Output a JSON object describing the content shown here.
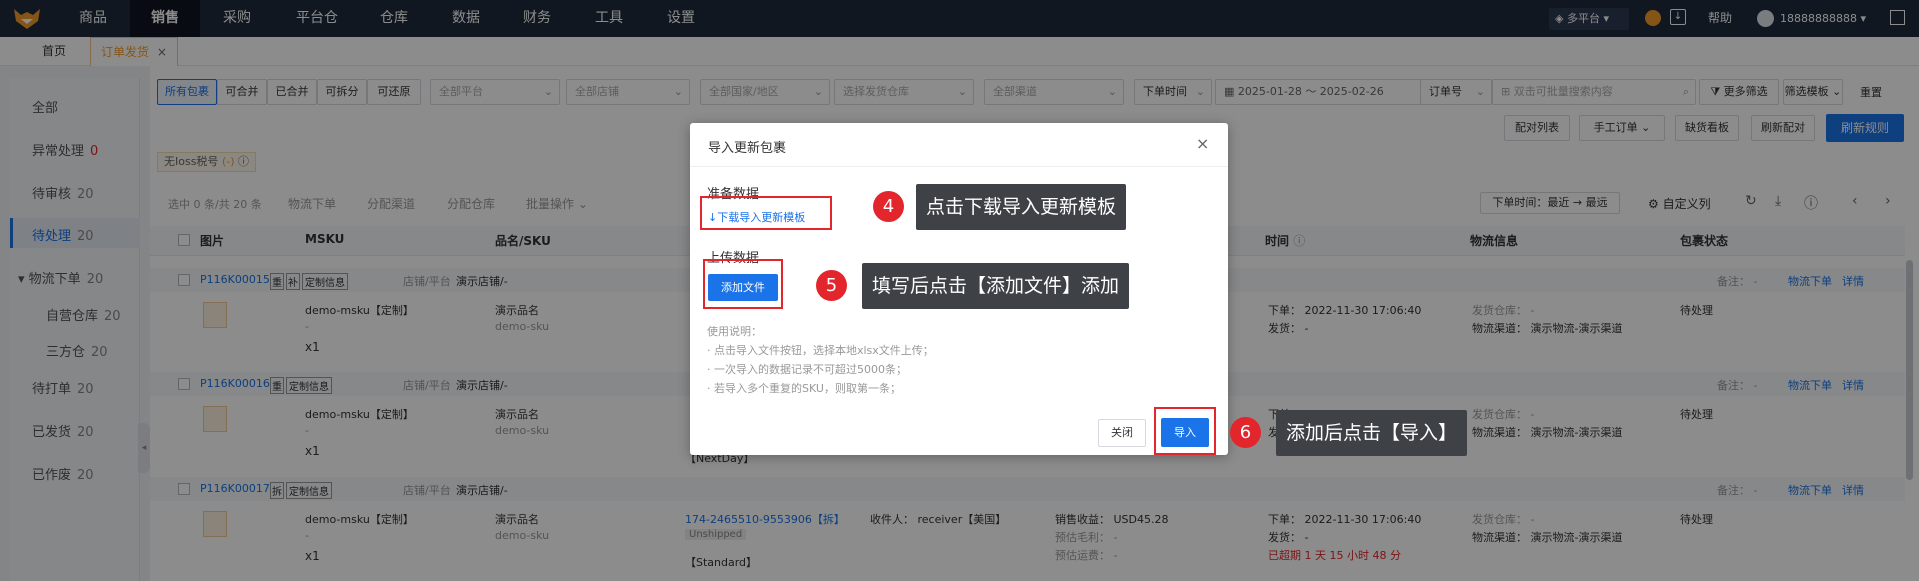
{
  "nav": {
    "items": [
      "商品",
      "销售",
      "采购",
      "平台仓",
      "仓库",
      "数据",
      "财务",
      "工具",
      "设置"
    ],
    "platform": "多平台",
    "help": "帮助",
    "user": "18888888888"
  },
  "tabs": {
    "home": "首页",
    "order": "订单发货"
  },
  "sidebar": {
    "items": [
      {
        "label": "全部",
        "count": ""
      },
      {
        "label": "异常处理",
        "count": "0"
      },
      {
        "label": "待审核",
        "count": "20"
      },
      {
        "label": "待处理",
        "count": "20"
      },
      {
        "label": "物流下单",
        "count": "20"
      },
      {
        "label": "自营仓库",
        "count": "20"
      },
      {
        "label": "三方仓",
        "count": "20"
      },
      {
        "label": "待打单",
        "count": "20"
      },
      {
        "label": "已发货",
        "count": "20"
      },
      {
        "label": "已作废",
        "count": "20"
      }
    ]
  },
  "filters": {
    "segments": [
      "所有包裹",
      "可合并",
      "已合并",
      "可拆分",
      "可还原"
    ],
    "platform": "全部平台",
    "shop": "全部店铺",
    "country": "全部国家/地区",
    "warehouse": "选择发货仓库",
    "channel": "全部渠道",
    "time_type": "下单时间",
    "date_range": "2025-01-28 ～ 2025-02-26",
    "order_no": "订单号",
    "search_placeholder": "双击可批量搜索内容",
    "more_filter": "更多筛选",
    "filter_template": "筛选模板",
    "reset": "重置"
  },
  "actions": {
    "match_list": "配对列表",
    "manual_order": "手工订单",
    "stock_board": "缺货看板",
    "refresh_match": "刷新配对",
    "refresh_rules": "刷新规则"
  },
  "tax_tag": "无Ioss税号",
  "tax_tag_count": "(-)",
  "toolbar": {
    "selected": "选中 0 条/共 20 条",
    "logistics_order": "物流下单",
    "assign_channel": "分配渠道",
    "assign_warehouse": "分配仓库",
    "batch_ops": "批量操作",
    "sort": "下单时间：最近 → 最远",
    "custom_cols": "自定义列"
  },
  "table": {
    "headers": [
      "图片",
      "MSKU",
      "品名/SKU",
      "时间",
      "物流信息",
      "包裹状态"
    ],
    "rows": [
      {
        "id": "P116K00015",
        "tags": [
          "重",
          "补"
        ],
        "custom": "定制信息",
        "shop_label": "店铺/平台",
        "shop": "演示店铺/-",
        "msku": "demo-msku【定制】",
        "dash": "-",
        "qty": "x1",
        "name": "演示品名",
        "sku": "demo-sku",
        "order_time": "下单： 2022-11-30 17:06:40",
        "ship": "发货： -",
        "wh": "发货仓库： -",
        "ch": "物流渠道： 演示物流-演示渠道",
        "status": "待处理",
        "note": "备注： -",
        "act1": "物流下单",
        "act2": "详情"
      },
      {
        "id": "P116K00016",
        "tags": [
          "重"
        ],
        "custom": "定制信息",
        "shop_label": "店铺/平台",
        "shop": "演示店铺/-",
        "msku": "demo-msku【定制】",
        "dash": "-",
        "qty": "x1",
        "name": "演示品名",
        "sku": "demo-sku",
        "order_time": "下单： 2022-11-30 17:06:40",
        "ship": "发货： -",
        "wh": "发货仓库： -",
        "ch": "物流渠道： 演示物流-演示渠道",
        "status": "待处理",
        "note": "备注： -",
        "act1": "物流下单",
        "act2": "详情",
        "service": "【NextDay】"
      },
      {
        "id": "P116K00017",
        "tags": [
          "拆"
        ],
        "custom": "定制信息",
        "shop_label": "店铺/平台",
        "shop": "演示店铺/-",
        "msku": "demo-msku【定制】",
        "dash": "-",
        "qty": "x1",
        "name": "演示品名",
        "sku": "demo-sku",
        "order_no": "174-2465510-9553906【拆】",
        "unshipped": "Unshipped",
        "service": "【Standard】",
        "receiver": "收件人： receiver【美国】",
        "sales": "销售收益： USD45.28",
        "profit": "预估毛利： -",
        "freight": "预估运费： -",
        "order_time": "下单： 2022-11-30 17:06:40",
        "ship": "发货： -",
        "overdue": "已超期 1 天 15 小时 48 分",
        "wh": "发货仓库： -",
        "ch": "物流渠道： 演示物流-演示渠道",
        "status": "待处理",
        "note": "备注： -",
        "act1": "物流下单",
        "act2": "详情"
      }
    ]
  },
  "modal": {
    "title": "导入更新包裹",
    "prepare": "准备数据",
    "download_link": "下载导入更新模板",
    "upload": "上传数据",
    "add_file": "添加文件",
    "usage_title": "使用说明：",
    "usage": [
      "· 点击导入文件按钮，选择本地xlsx文件上传；",
      "· 一次导入的数据记录不可超过5000条；",
      "· 若导入多个重复的SKU，则取第一条；"
    ],
    "close": "关闭",
    "import": "导入"
  },
  "callouts": [
    {
      "num": "4",
      "text": "点击下载导入更新模板"
    },
    {
      "num": "5",
      "text": "填写后点击【添加文件】添加"
    },
    {
      "num": "6",
      "text": "添加后点击【导入】"
    }
  ],
  "colors": {
    "primary": "#1a73e8",
    "topbar": "#1f2a3d",
    "annotation": "#e3262b"
  }
}
